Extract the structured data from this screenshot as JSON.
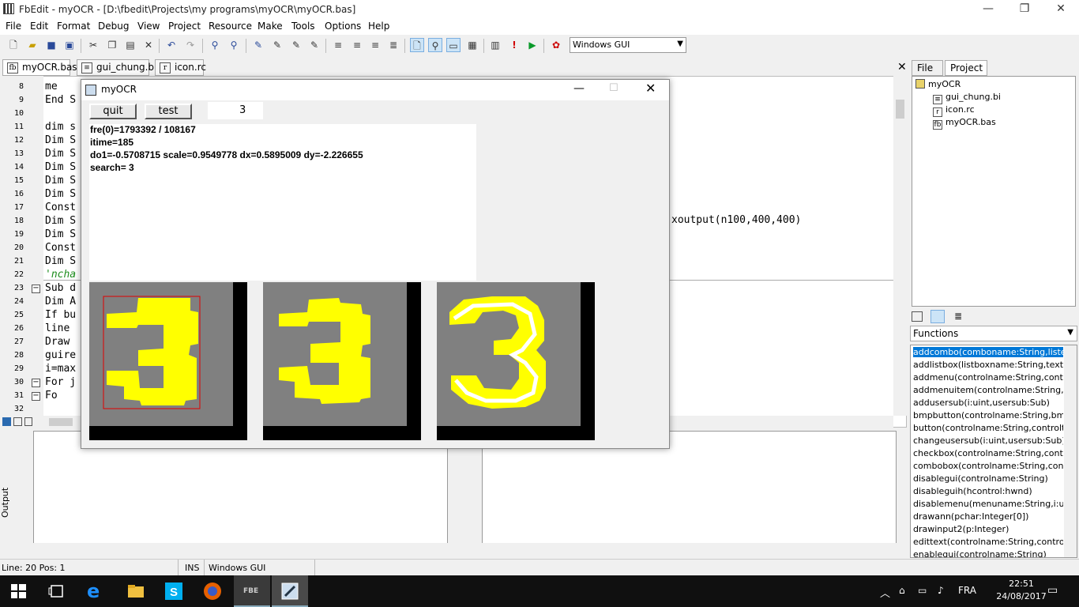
{
  "window": {
    "title": "FbEdit - myOCR - [D:\\fbedit\\Projects\\my programs\\myOCR\\myOCR.bas]",
    "minimize": "—",
    "restore": "❐",
    "close": "✕"
  },
  "menu": [
    "File",
    "Edit",
    "Format",
    "Debug",
    "View",
    "Project",
    "Resource",
    "Make",
    "Tools",
    "Options",
    "Help"
  ],
  "toolbar": {
    "build_target": "Windows GUI"
  },
  "tabs": [
    {
      "label": "myOCR.bas",
      "icon": "fb"
    },
    {
      "label": "gui_chung.bi",
      "icon": "document"
    },
    {
      "label": "icon.rc",
      "icon": "r"
    }
  ],
  "editor": {
    "lines": [
      {
        "n": "8",
        "text": "   me"
      },
      {
        "n": "9",
        "text": "End S"
      },
      {
        "n": "10",
        "text": ""
      },
      {
        "n": "11",
        "text": "dim s"
      },
      {
        "n": "12",
        "text": "Dim S"
      },
      {
        "n": "13",
        "text": "Dim S"
      },
      {
        "n": "14",
        "text": "Dim S"
      },
      {
        "n": "15",
        "text": "Dim S"
      },
      {
        "n": "16",
        "text": "Dim S"
      },
      {
        "n": "17",
        "text": "Const"
      },
      {
        "n": "18",
        "text": "Dim S"
      },
      {
        "n": "19",
        "text": "Dim S"
      },
      {
        "n": "20",
        "text": "Const"
      },
      {
        "n": "21",
        "text": "Dim S"
      },
      {
        "n": "22",
        "text": "'ncha"
      },
      {
        "n": "23",
        "text": "Sub d"
      },
      {
        "n": "24",
        "text": "Dim A"
      },
      {
        "n": "25",
        "text": "If bu"
      },
      {
        "n": "26",
        "text": "line "
      },
      {
        "n": "27",
        "text": "Draw "
      },
      {
        "n": "28",
        "text": "guire"
      },
      {
        "n": "29",
        "text": "i=max"
      },
      {
        "n": "30",
        "text": "For j"
      },
      {
        "n": "31",
        "text": "  Fo"
      },
      {
        "n": "32",
        "text": ""
      }
    ],
    "visible_tail": "xoutput(n100,400,400)"
  },
  "output_label": "Output",
  "right_panel": {
    "tabs": [
      "File",
      "Project"
    ],
    "tree": [
      {
        "label": "myOCR"
      },
      {
        "label": "gui_chung.bi"
      },
      {
        "label": "icon.rc"
      },
      {
        "label": "myOCR.bas"
      }
    ],
    "functions_label": "Functions",
    "functions": [
      "addcombo(comboname:String,liste:Strin",
      "addlistbox(listboxname:String,text:Str",
      "addmenu(controlname:String,controlte",
      "addmenuitem(controlname:String,cont",
      "addusersub(i:uint,usersub:Sub)",
      "bmpbutton(controlname:String,bmpfile",
      "button(controlname:String,controltext",
      "changeusersub(i:uint,usersub:Sub)",
      "checkbox(controlname:String,controlte",
      "combobox(controlname:String,controls",
      "disablegui(controlname:String)",
      "disableguih(hcontrol:hwnd)",
      "disablemenu(menuname:String,i:uint)",
      "drawann(pchar:Integer[0])",
      "drawinput2(p:Integer)",
      "edittext(controlname:String,controltex",
      "enablegui(controlname:String)"
    ]
  },
  "status": {
    "position": "Line: 20 Pos: 1",
    "mode": "INS",
    "target": "Windows GUI"
  },
  "taskbar": {
    "time": "22:51",
    "date": "24/08/2017",
    "lang": "FRA"
  },
  "myocr": {
    "title": "myOCR",
    "quit": "quit",
    "test": "test",
    "result_field": "3",
    "lines": [
      "fre(0)=1793392 / 108167",
      "itime=185",
      "do1=-0.5708715  scale=0.9549778 dx=0.5895009  dy=-2.226655",
      "search= 3"
    ]
  }
}
